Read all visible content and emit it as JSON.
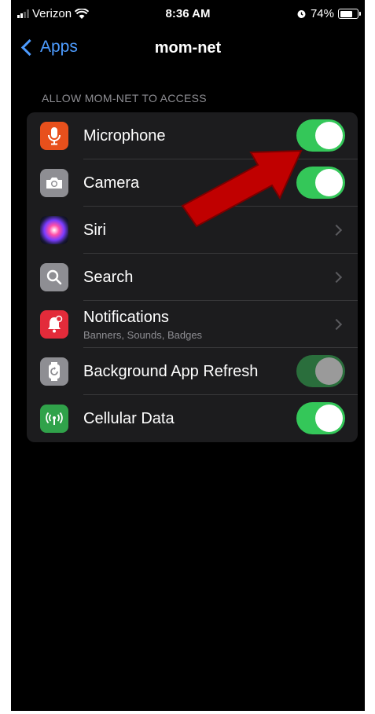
{
  "status_bar": {
    "carrier": "Verizon",
    "time": "8:36 AM",
    "battery": "74%",
    "battery_level": 0.74
  },
  "nav": {
    "back_label": "Apps",
    "title": "mom-net"
  },
  "section_header": "ALLOW MOM-NET TO ACCESS",
  "settings": {
    "microphone": {
      "label": "Microphone",
      "enabled": true
    },
    "camera": {
      "label": "Camera",
      "enabled": true
    },
    "siri": {
      "label": "Siri"
    },
    "search": {
      "label": "Search"
    },
    "notifications": {
      "label": "Notifications",
      "sublabel": "Banners, Sounds, Badges"
    },
    "background_refresh": {
      "label": "Background App Refresh",
      "enabled": true,
      "disabled": true
    },
    "cellular": {
      "label": "Cellular Data",
      "enabled": true
    }
  },
  "colors": {
    "accent": "#4d9cff",
    "toggle_on": "#34c759",
    "microphone_icon": "#e8501c",
    "camera_icon": "#8e8e93",
    "search_icon": "#8e8e93",
    "notifications_icon": "#e32b3a",
    "background_refresh_icon": "#8e8e93",
    "cellular_icon": "#30a24a",
    "annotation_arrow": "#c00000"
  }
}
